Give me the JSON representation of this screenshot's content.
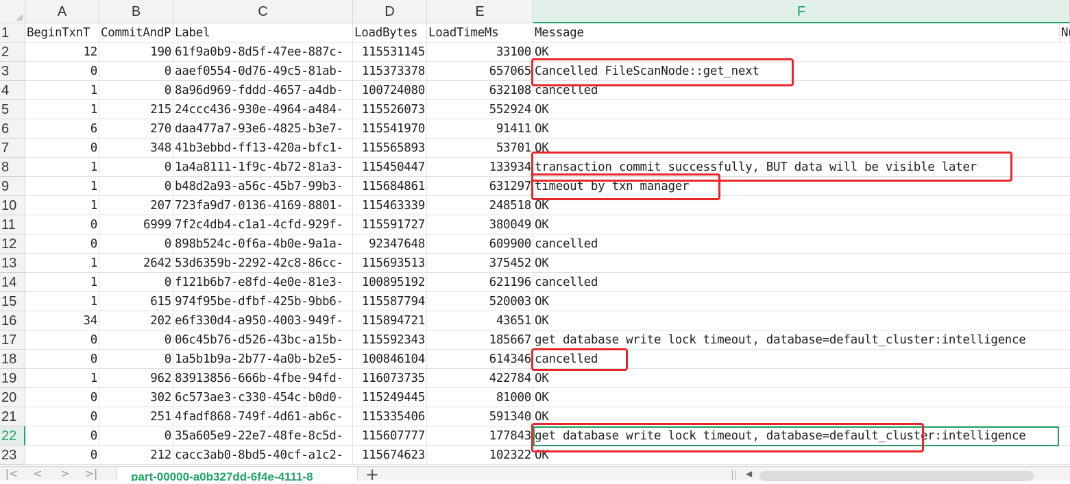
{
  "columns": [
    {
      "letter": "A",
      "active": false
    },
    {
      "letter": "B",
      "active": false
    },
    {
      "letter": "C",
      "active": false
    },
    {
      "letter": "D",
      "active": false
    },
    {
      "letter": "E",
      "active": false
    },
    {
      "letter": "F",
      "active": true
    }
  ],
  "headers": [
    "BeginTxnT",
    "CommitAndP",
    "Label",
    "LoadBytes",
    "LoadTimeMs",
    "Message",
    "Nu"
  ],
  "rows": [
    {
      "n": "2",
      "a": "12",
      "b": "190",
      "c": "61f9a0b9-8d5f-47ee-887c-",
      "d": "115531145",
      "e": "33100",
      "f": "OK"
    },
    {
      "n": "3",
      "a": "0",
      "b": "0",
      "c": "aaef0554-0d76-49c5-81ab-",
      "d": "115373378",
      "e": "657065",
      "f": "Cancelled FileScanNode::get_next"
    },
    {
      "n": "4",
      "a": "1",
      "b": "0",
      "c": "8a96d969-fddd-4657-a4db-",
      "d": "100724080",
      "e": "632108",
      "f": "cancelled"
    },
    {
      "n": "5",
      "a": "1",
      "b": "215",
      "c": "24ccc436-930e-4964-a484-",
      "d": "115526073",
      "e": "552924",
      "f": "OK"
    },
    {
      "n": "6",
      "a": "6",
      "b": "270",
      "c": "daa477a7-93e6-4825-b3e7-",
      "d": "115541970",
      "e": "91411",
      "f": "OK"
    },
    {
      "n": "7",
      "a": "0",
      "b": "348",
      "c": "41b3ebbd-ff13-420a-bfc1-",
      "d": "115565893",
      "e": "53701",
      "f": "OK"
    },
    {
      "n": "8",
      "a": "1",
      "b": "0",
      "c": "1a4a8111-1f9c-4b72-81a3-",
      "d": "115450447",
      "e": "133934",
      "f": "transaction commit successfully, BUT data will be visible later"
    },
    {
      "n": "9",
      "a": "1",
      "b": "0",
      "c": "b48d2a93-a56c-45b7-99b3-",
      "d": "115684861",
      "e": "631297",
      "f": "timeout by txn manager"
    },
    {
      "n": "10",
      "a": "1",
      "b": "207",
      "c": "723fa9d7-0136-4169-8801-",
      "d": "115463339",
      "e": "248518",
      "f": "OK"
    },
    {
      "n": "11",
      "a": "0",
      "b": "6999",
      "c": "7f2c4db4-c1a1-4cfd-929f-",
      "d": "115591727",
      "e": "380049",
      "f": "OK"
    },
    {
      "n": "12",
      "a": "0",
      "b": "0",
      "c": "898b524c-0f6a-4b0e-9a1a-",
      "d": "92347648",
      "e": "609900",
      "f": "cancelled"
    },
    {
      "n": "13",
      "a": "1",
      "b": "2642",
      "c": "53d6359b-2292-42c8-86cc-",
      "d": "115693513",
      "e": "375452",
      "f": "OK"
    },
    {
      "n": "14",
      "a": "1",
      "b": "0",
      "c": "f121b6b7-e8fd-4e0e-81e3-",
      "d": "100895192",
      "e": "621196",
      "f": "cancelled"
    },
    {
      "n": "15",
      "a": "1",
      "b": "615",
      "c": "974f95be-dfbf-425b-9bb6-",
      "d": "115587794",
      "e": "520003",
      "f": "OK"
    },
    {
      "n": "16",
      "a": "34",
      "b": "202",
      "c": "e6f330d4-a950-4003-949f-",
      "d": "115894721",
      "e": "43651",
      "f": "OK"
    },
    {
      "n": "17",
      "a": "0",
      "b": "0",
      "c": "06c45b76-d526-43bc-a15b-",
      "d": "115592343",
      "e": "185667",
      "f": "get database write lock timeout, database=default_cluster:intelligence"
    },
    {
      "n": "18",
      "a": "0",
      "b": "0",
      "c": "1a5b1b9a-2b77-4a0b-b2e5-",
      "d": "100846104",
      "e": "614346",
      "f": "cancelled"
    },
    {
      "n": "19",
      "a": "1",
      "b": "962",
      "c": "83913856-666b-4fbe-94fd-",
      "d": "116073735",
      "e": "422784",
      "f": "OK"
    },
    {
      "n": "20",
      "a": "0",
      "b": "302",
      "c": "6c573ae3-c330-454c-b0d0-",
      "d": "115249445",
      "e": "81000",
      "f": "OK"
    },
    {
      "n": "21",
      "a": "0",
      "b": "251",
      "c": "4fadf868-749f-4d61-ab6c-",
      "d": "115335406",
      "e": "591340",
      "f": "OK"
    },
    {
      "n": "22",
      "a": "0",
      "b": "0",
      "c": "35a605e9-22e7-48fe-8c5d-",
      "d": "115607777",
      "e": "177843",
      "f": "get database write lock timeout, database=default_cluster:intelligence",
      "active": true
    },
    {
      "n": "23",
      "a": "0",
      "b": "212",
      "c": "cacc3ab0-8bd5-40cf-a1c2-",
      "d": "115674623",
      "e": "102322",
      "f": "OK"
    }
  ],
  "sheet_tab": "part-00000-a0b327dd-6f4e-4111-8",
  "add_sheet": "+",
  "nav": [
    "|<",
    "<",
    ">",
    ">|"
  ],
  "colors": {
    "accent": "#21a366",
    "annotation": "#e8262a"
  }
}
